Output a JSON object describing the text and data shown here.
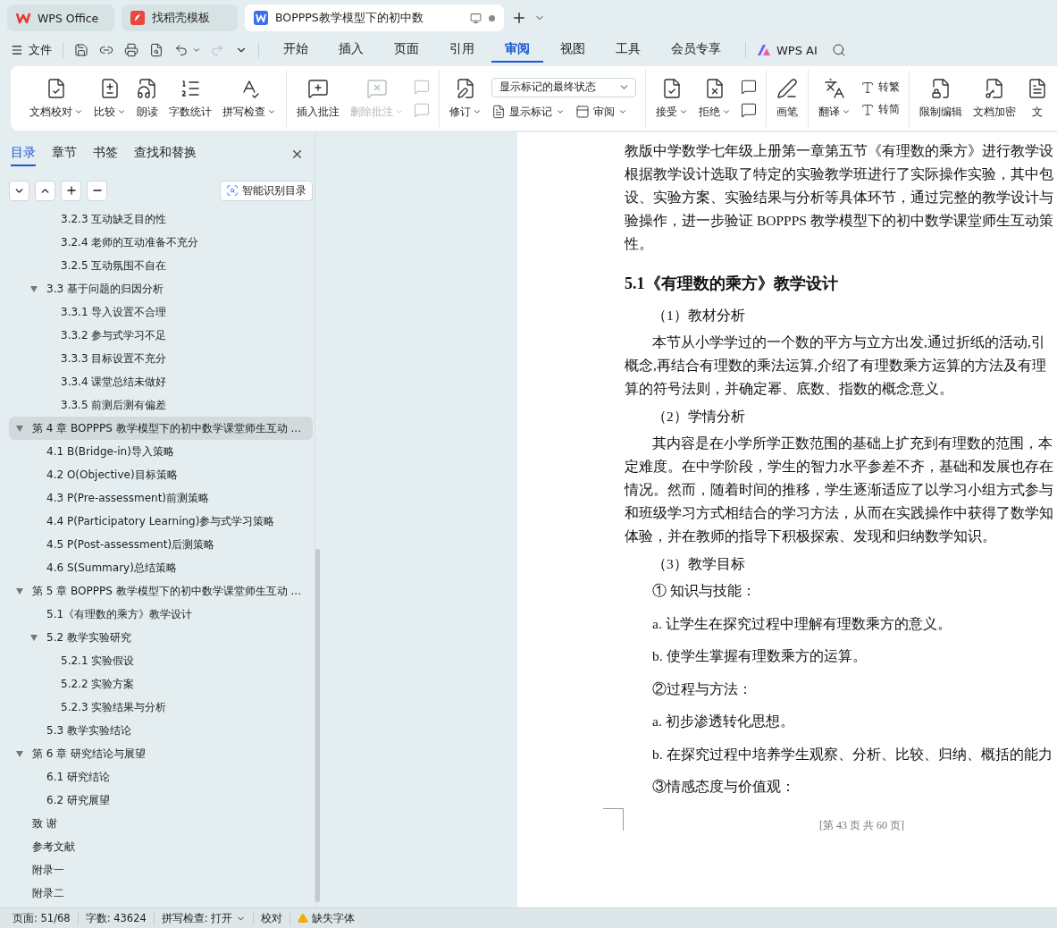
{
  "tabs": [
    {
      "kind": "wps",
      "label": "WPS Office",
      "selected": false
    },
    {
      "kind": "docer",
      "label": "找稻壳模板",
      "selected": false
    },
    {
      "kind": "writer",
      "label": "BOPPPS教学模型下的初中数",
      "selected": true
    }
  ],
  "menu": {
    "file": "文件",
    "tabs": [
      {
        "label": "开始",
        "selected": false
      },
      {
        "label": "插入",
        "selected": false
      },
      {
        "label": "页面",
        "selected": false
      },
      {
        "label": "引用",
        "selected": false
      },
      {
        "label": "审阅",
        "selected": true
      },
      {
        "label": "视图",
        "selected": false
      },
      {
        "label": "工具",
        "selected": false
      },
      {
        "label": "会员专享",
        "selected": false
      }
    ],
    "ai": "WPS AI"
  },
  "ribbon": [
    {
      "items": [
        {
          "kind": "large",
          "label": "文档校对",
          "dropdown": true,
          "disabled": false
        },
        {
          "kind": "large",
          "label": "比较",
          "dropdown": true,
          "disabled": false
        },
        {
          "kind": "large",
          "label": "朗读",
          "dropdown": false,
          "disabled": false
        },
        {
          "kind": "large",
          "label": "字数统计",
          "dropdown": false,
          "disabled": false
        },
        {
          "kind": "large",
          "label": "拼写检查",
          "dropdown": true,
          "disabled": false
        }
      ]
    },
    {
      "items": [
        {
          "kind": "large",
          "label": "插入批注",
          "dropdown": false,
          "disabled": false
        },
        {
          "kind": "large",
          "label": "删除批注",
          "dropdown": true,
          "disabled": true
        },
        {
          "kind": "iconcol",
          "disabled": true
        }
      ]
    },
    {
      "items": [
        {
          "kind": "large",
          "label": "修订",
          "dropdown": true,
          "disabled": false
        },
        {
          "kind": "markup",
          "select": "显示标记的最终状态",
          "buttons": [
            "显示标记",
            "审阅"
          ]
        }
      ]
    },
    {
      "items": [
        {
          "kind": "large",
          "label": "接受",
          "dropdown": true,
          "disabled": false
        },
        {
          "kind": "large",
          "label": "拒绝",
          "dropdown": true,
          "disabled": false
        },
        {
          "kind": "iconcol",
          "disabled": false
        }
      ]
    },
    {
      "items": [
        {
          "kind": "large",
          "label": "画笔",
          "dropdown": false,
          "disabled": false
        }
      ]
    },
    {
      "items": [
        {
          "kind": "large",
          "label": "翻译",
          "dropdown": true,
          "disabled": false
        },
        {
          "kind": "smallcol",
          "buttons": [
            "转繁",
            "转简"
          ]
        }
      ]
    },
    {
      "items": [
        {
          "kind": "large",
          "label": "限制编辑",
          "dropdown": false,
          "disabled": false
        },
        {
          "kind": "large",
          "label": "文档加密",
          "dropdown": false,
          "disabled": false
        },
        {
          "kind": "large",
          "label": "文",
          "dropdown": false,
          "disabled": false
        }
      ]
    }
  ],
  "sidebar": {
    "tabs": [
      {
        "label": "目录",
        "selected": true
      },
      {
        "label": "章节",
        "selected": false
      },
      {
        "label": "书签",
        "selected": false
      },
      {
        "label": "查找和替换",
        "selected": false
      }
    ],
    "smart_button": "智能识别目录",
    "toc": [
      {
        "children": [
          {
            "children": [
              {
                "label": "3.2.3 互动缺乏目的性",
                "selected": false
              },
              {
                "label": "3.2.4 老师的互动准备不充分",
                "selected": false
              },
              {
                "label": "3.2.5 互动氛围不自在",
                "selected": false
              }
            ]
          },
          {
            "label": "3.3 基于问题的归因分析",
            "selected": false,
            "expanded": true,
            "children": [
              {
                "label": "3.3.1 导入设置不合理",
                "selected": false
              },
              {
                "label": "3.3.2 参与式学习不足",
                "selected": false
              },
              {
                "label": "3.3.3 目标设置不充分",
                "selected": false
              },
              {
                "label": "3.3.4 课堂总结未做好",
                "selected": false
              },
              {
                "label": "3.3.5 前测后测有偏差",
                "selected": false
              }
            ]
          }
        ]
      },
      {
        "label": "第 4 章  BOPPPS 教学模型下的初中数学课堂师生互动 ...",
        "selected": true,
        "expanded": true,
        "children": [
          {
            "label": "4.1 B(Bridge-in)导入策略",
            "selected": false
          },
          {
            "label": "4.2 O(Objective)目标策略",
            "selected": false
          },
          {
            "label": "4.3 P(Pre-assessment)前测策略",
            "selected": false
          },
          {
            "label": "4.4 P(Participatory Learning)参与式学习策略",
            "selected": false
          },
          {
            "label": "4.5 P(Post-assessment)后测策略",
            "selected": false
          },
          {
            "label": "4.6 S(Summary)总结策略",
            "selected": false
          }
        ]
      },
      {
        "label": "第 5 章  BOPPPS 教学模型下的初中数学课堂师生互动 ...",
        "selected": false,
        "expanded": true,
        "children": [
          {
            "label": "5.1《有理数的乘方》教学设计",
            "selected": false
          },
          {
            "label": "5.2 教学实验研究",
            "selected": false,
            "expanded": true,
            "children": [
              {
                "label": "5.2.1 实验假设",
                "selected": false
              },
              {
                "label": "5.2.2 实验方案",
                "selected": false
              },
              {
                "label": "5.2.3 实验结果与分析",
                "selected": false
              }
            ]
          },
          {
            "label": "5.3 教学实验结论",
            "selected": false
          }
        ]
      },
      {
        "label": "第 6 章  研究结论与展望",
        "selected": false,
        "expanded": true,
        "children": [
          {
            "label": "6.1 研究结论",
            "selected": false
          },
          {
            "label": "6.2 研究展望",
            "selected": false
          }
        ]
      },
      {
        "label": "致  谢",
        "selected": false
      },
      {
        "label": "参考文献",
        "selected": false
      },
      {
        "label": "附录一",
        "selected": false
      },
      {
        "label": "附录二",
        "selected": false
      }
    ]
  },
  "document": {
    "blocks": [
      {
        "kind": "para",
        "indent": false,
        "lines": [
          "教版中学数学七年级上册第一章第五节《有理数的乘方》进行教学设",
          "根据教学设计选取了特定的实验教学班进行了实际操作实验，其中包",
          "设、实验方案、实验结果与分析等具体环节，通过完整的教学设计与",
          "验操作，进一步验证 BOPPPS 教学模型下的初中数学课堂师生互动策",
          "性。"
        ]
      },
      {
        "kind": "heading",
        "text": "5.1《有理数的乘方》教学设计"
      },
      {
        "kind": "subhead",
        "text": "（1）教材分析"
      },
      {
        "kind": "para",
        "indent": true,
        "lines": [
          "本节从小学学过的一个数的平方与立方出发,通过折纸的活动,引",
          "概念,再结合有理数的乘法运算,介绍了有理数乘方运算的方法及有理",
          "算的符号法则，并确定幂、底数、指数的概念意义。"
        ]
      },
      {
        "kind": "subhead",
        "text": "（2）学情分析"
      },
      {
        "kind": "para",
        "indent": true,
        "lines": [
          "其内容是在小学所学正数范围的基础上扩充到有理数的范围，本",
          "定难度。在中学阶段，学生的智力水平参差不齐，基础和发展也存在",
          "情况。然而，随着时间的推移，学生逐渐适应了以学习小组方式参与",
          "和班级学习方式相结合的学习方法，从而在实践操作中获得了数学知",
          "体验，并在教师的指导下积极探索、发现和归纳数学知识。"
        ]
      },
      {
        "kind": "subhead",
        "text": "（3）教学目标"
      },
      {
        "kind": "item",
        "text": "① 知识与技能："
      },
      {
        "kind": "item",
        "text": "a. 让学生在探究过程中理解有理数乘方的意义。"
      },
      {
        "kind": "item",
        "text": "b. 使学生掌握有理数乘方的运算。"
      },
      {
        "kind": "item",
        "text": "②过程与方法："
      },
      {
        "kind": "item",
        "text": "a. 初步渗透转化思想。"
      },
      {
        "kind": "item",
        "text": "b. 在探究过程中培养学生观察、分析、比较、归纳、概括的能力"
      },
      {
        "kind": "item",
        "text": "③情感态度与价值观："
      }
    ],
    "footer": "[第 43 页  共 60 页]"
  },
  "status_bar": [
    {
      "kind": "text",
      "label": "页面: 51/68"
    },
    {
      "kind": "text",
      "label": "字数: 43624"
    },
    {
      "kind": "dropdown",
      "label": "拼写检查: 打开"
    },
    {
      "kind": "text",
      "label": "校对"
    },
    {
      "kind": "warning",
      "label": "缺失字体"
    }
  ]
}
